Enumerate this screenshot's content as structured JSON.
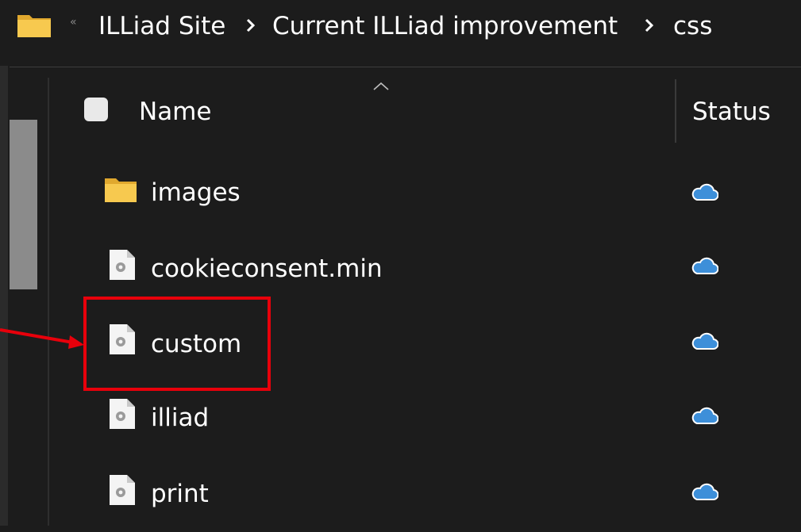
{
  "breadcrumb": {
    "overflow_glyph": "«",
    "items": [
      "ILLiad Site",
      "Current ILLiad improvement",
      "css"
    ]
  },
  "header": {
    "name_label": "Name",
    "status_label": "Status",
    "sort_direction": "ascending"
  },
  "files": [
    {
      "name": "images",
      "type": "folder",
      "status_icon": "cloud-icon"
    },
    {
      "name": "cookieconsent.min",
      "type": "css-file",
      "status_icon": "cloud-icon"
    },
    {
      "name": "custom",
      "type": "css-file",
      "status_icon": "cloud-icon",
      "highlighted": true
    },
    {
      "name": "illiad",
      "type": "css-file",
      "status_icon": "cloud-icon"
    },
    {
      "name": "print",
      "type": "css-file",
      "status_icon": "cloud-icon"
    }
  ],
  "colors": {
    "background": "#1c1c1c",
    "highlight": "#e8000b",
    "folder": "#f7c14a",
    "cloud": "#3d8fd9"
  }
}
